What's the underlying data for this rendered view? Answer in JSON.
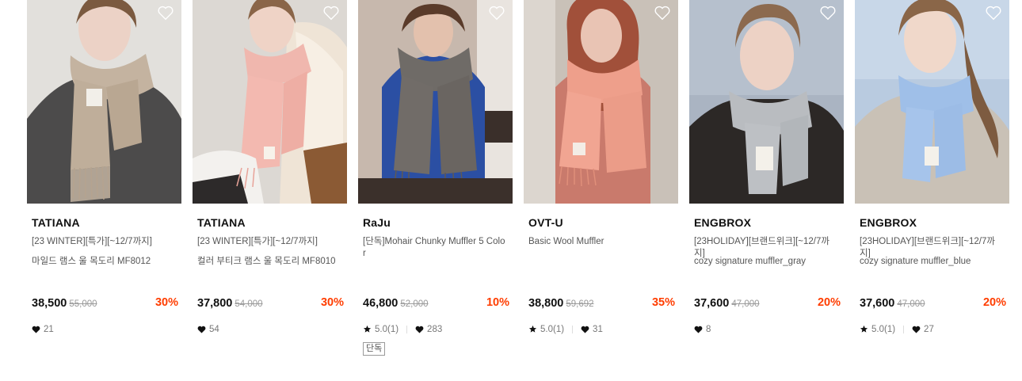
{
  "products": [
    {
      "brand": "TATIANA",
      "name_a": "[23 WINTER][특가][~12/7까지]",
      "name_b": "마일드 램스 울 목도리 MF8012",
      "price": "38,500",
      "original_price": "55,000",
      "discount": "30%",
      "rating": "",
      "likes": "21",
      "tag": ""
    },
    {
      "brand": "TATIANA",
      "name_a": "[23 WINTER][특가][~12/7까지]",
      "name_b": "컬러 부티크 램스 울 목도리 MF8010",
      "price": "37,800",
      "original_price": "54,000",
      "discount": "30%",
      "rating": "",
      "likes": "54",
      "tag": ""
    },
    {
      "brand": "RaJu",
      "name_a": "[단독]Mohair Chunky Muffler 5 Color",
      "name_b": "",
      "price": "46,800",
      "original_price": "52,000",
      "discount": "10%",
      "rating": "5.0(1)",
      "likes": "283",
      "tag": "단독"
    },
    {
      "brand": "OVT-U",
      "name_a": "Basic Wool Muffler",
      "name_b": "",
      "price": "38,800",
      "original_price": "59,692",
      "discount": "35%",
      "rating": "5.0(1)",
      "likes": "31",
      "tag": ""
    },
    {
      "brand": "ENGBROX",
      "name_a": "[23HOLIDAY][브랜드위크][~12/7까지]",
      "name_b": "cozy signature muffler_gray",
      "price": "37,600",
      "original_price": "47,000",
      "discount": "20%",
      "rating": "",
      "likes": "8",
      "tag": ""
    },
    {
      "brand": "ENGBROX",
      "name_a": "[23HOLIDAY][브랜드위크][~12/7까지]",
      "name_b": "cozy signature muffler_blue",
      "price": "37,600",
      "original_price": "47,000",
      "discount": "20%",
      "rating": "5.0(1)",
      "likes": "27",
      "tag": ""
    }
  ],
  "colors": {
    "discount": "#ff3d00",
    "price": "#111111",
    "muted": "#9a9a9a"
  }
}
